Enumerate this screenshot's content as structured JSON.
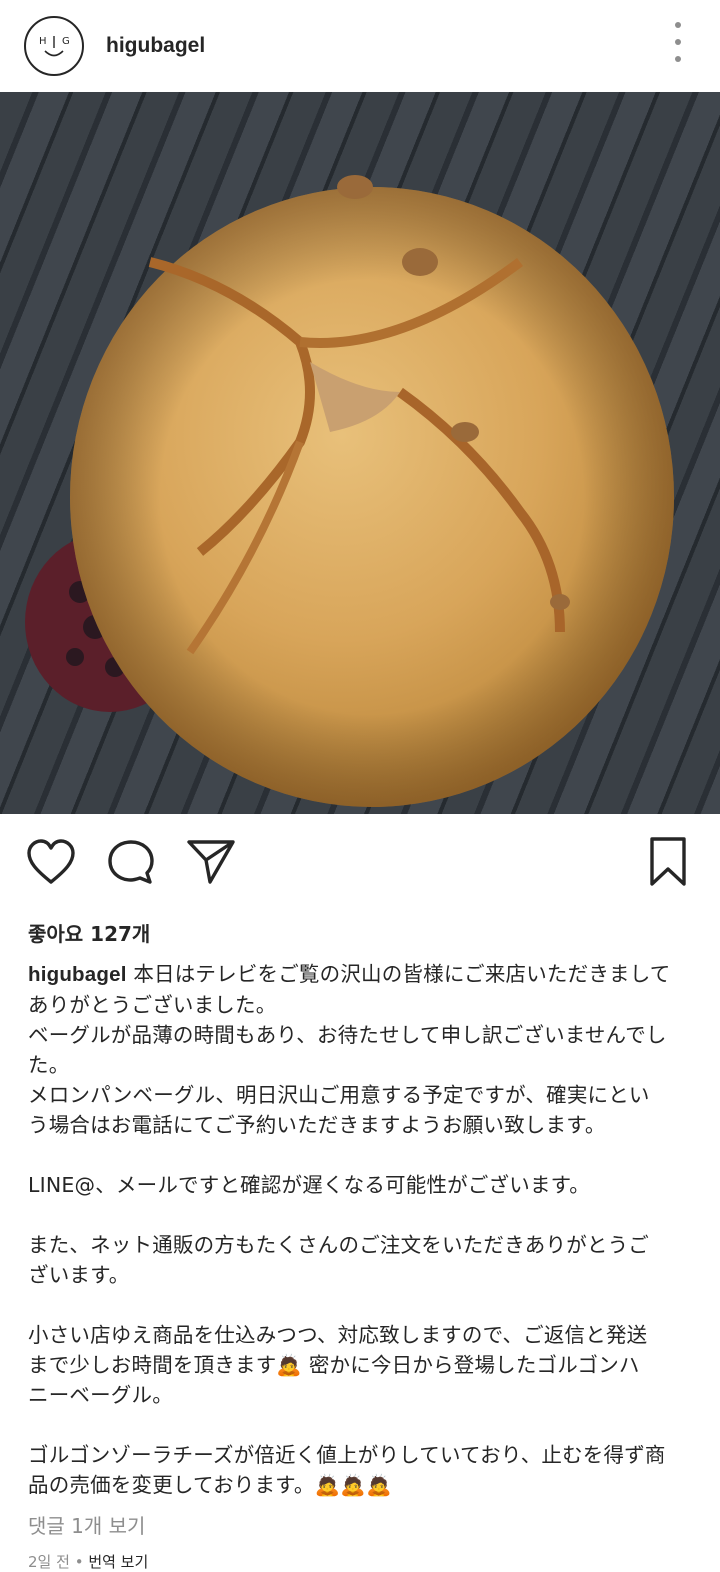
{
  "post": {
    "username": "higubagel",
    "avatar_text": "H G",
    "likes_text": "좋아요 127개",
    "caption_user": "higubagel",
    "caption_text": " 本日はテレビをご覧の沢山の皆様にご来店いただきまして\nありがとうございました。\nベーグルが品薄の時間もあり、お待たせして申し訳ございませんでし\nた。\nメロンパンベーグル、明日沢山ご用意する予定ですが、確実にとい\nう場合はお電話にてご予約いただきますようお願い致します。\n\nLINE@、メールですと確認が遅くなる可能性がございます。\n\nまた、ネット通販の方もたくさんのご注文をいただきありがとうご\nざいます。\n\n小さい店ゆえ商品を仕込みつつ、対応致しますので、ご返信と発送\nまで少しお時間を頂きます🙇 密かに今日から登場したゴルゴンハ\nニーベーグル。\n\nゴルゴンゾーラチーズが倍近く値上がりしていており、止むを得ず商\n品の売価を変更しております。🙇🙇🙇",
    "comments_link": "댓글 1개 보기",
    "time_ago": "2일 전",
    "separator": " • ",
    "translate": "번역 보기"
  },
  "icons": {
    "more": "more-vertical-icon",
    "like": "heart-icon",
    "comment": "comment-icon",
    "share": "send-icon",
    "save": "bookmark-icon"
  }
}
